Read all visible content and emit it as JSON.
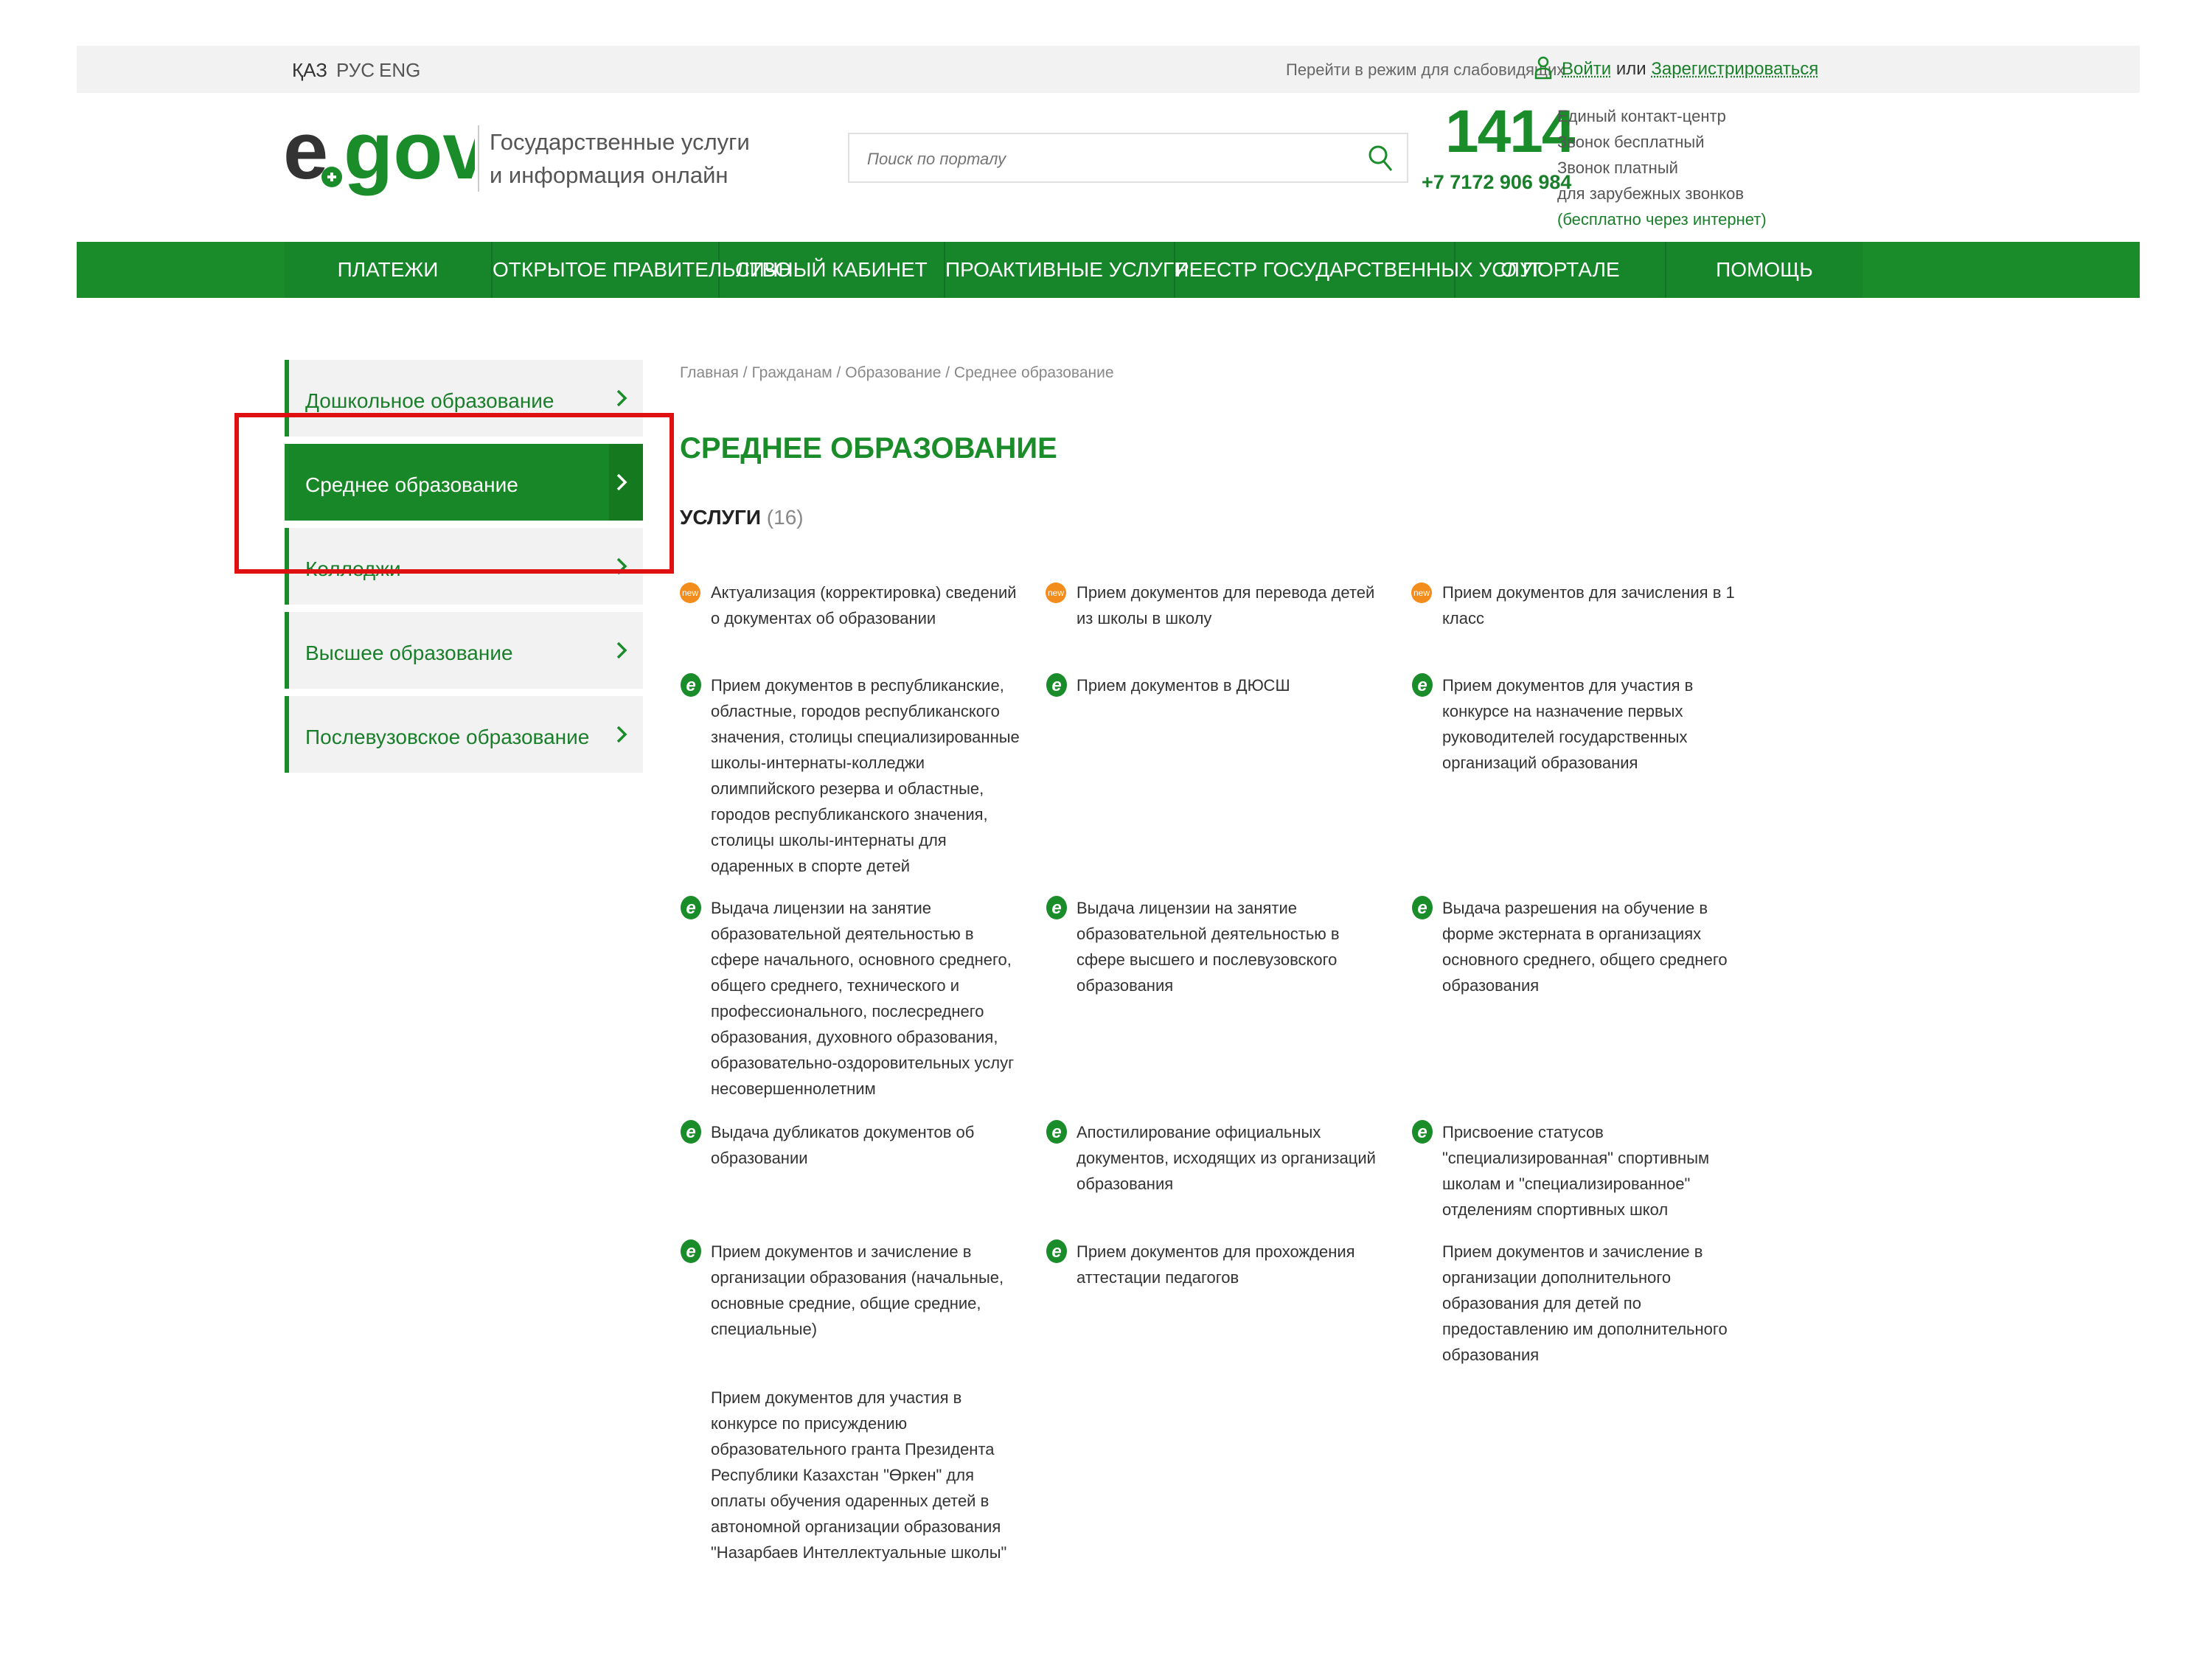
{
  "topbar": {
    "languages": [
      "ҚАЗ",
      "РУС",
      "ENG"
    ],
    "low_vision": "Перейти в режим для слабовидящих",
    "login": "Войти",
    "or": "или",
    "register": "Зарегистрироваться"
  },
  "header": {
    "logo_text": "e.gov",
    "tagline_line1": "Государственные услуги",
    "tagline_line2": "и информация онлайн",
    "search_placeholder": "Поиск по порталу",
    "contact_number": "1414",
    "contact_phone": "+7 7172 906 984",
    "contact_lines": [
      "Единый контакт-центр",
      "Звонок бесплатный",
      "Звонок платный",
      "для зарубежных звонков"
    ],
    "contact_link": "(бесплатно через интернет)"
  },
  "nav": {
    "items": [
      "ПЛАТЕЖИ",
      "ОТКРЫТОЕ ПРАВИТЕЛЬСТВО",
      "ЛИЧНЫЙ КАБИНЕТ",
      "ПРОАКТИВНЫЕ УСЛУГИ",
      "РЕЕСТР ГОСУДАРСТВЕННЫХ УСЛУГ",
      "О ПОРТАЛЕ",
      "ПОМОЩЬ"
    ]
  },
  "sidebar": {
    "items": [
      {
        "label": "Дошкольное образование",
        "active": false
      },
      {
        "label": "Среднее образование",
        "active": true
      },
      {
        "label": "Колледжи",
        "active": false
      },
      {
        "label": "Высшее образование",
        "active": false
      },
      {
        "label": "Послевузовское образование",
        "active": false
      }
    ]
  },
  "breadcrumb": {
    "items": [
      "Главная",
      "Гражданам",
      "Образование",
      "Среднее образование"
    ],
    "sep": " / "
  },
  "main": {
    "title": "СРЕДНЕЕ ОБРАЗОВАНИЕ",
    "services_label": "УСЛУГИ",
    "services_count": "(16)"
  },
  "services": [
    {
      "badge": "new",
      "text": "Актуализация (корректировка) сведений о документах об образовании"
    },
    {
      "badge": "new",
      "text": "Прием документов для перевода детей из школы в школу"
    },
    {
      "badge": "new",
      "text": "Прием документов для зачисления в 1 класс"
    },
    {
      "badge": "e",
      "text": "Прием документов в республиканские, областные, городов республиканского значения, столицы специализированные школы-интернаты-колледжи олимпийского резерва и областные, городов республиканского значения, столицы школы-интернаты для одаренных в спорте детей"
    },
    {
      "badge": "e",
      "text": "Прием документов в ДЮСШ"
    },
    {
      "badge": "e",
      "text": "Прием документов для участия в конкурсе на назначение первых руководителей государственных организаций образования"
    },
    {
      "badge": "e",
      "text": "Выдача лицензии на занятие образовательной деятельностью в сфере начального, основного среднего, общего среднего, технического и профессионального, послесреднего образования, духовного образования, образовательно-оздоровительных услуг несовершеннолетним"
    },
    {
      "badge": "e",
      "text": "Выдача лицензии на занятие образовательной деятельностью в сфере высшего и послевузовского образования"
    },
    {
      "badge": "e",
      "text": "Выдача разрешения на обучение в форме экстерната в организациях основного среднего, общего среднего образования"
    },
    {
      "badge": "e",
      "text": "Выдача дубликатов документов об образовании"
    },
    {
      "badge": "e",
      "text": "Апостилирование официальных документов, исходящих из организаций образования"
    },
    {
      "badge": "e",
      "text": "Присвоение статусов \"специализированная\" спортивным школам и \"специализированное\" отделениям спортивных школ"
    },
    {
      "badge": "e",
      "text": "Прием документов и зачисление в организации образования (начальные, основные средние, общие средние, специальные)"
    },
    {
      "badge": "e",
      "text": "Прием документов для прохождения аттестации педагогов"
    },
    {
      "badge": "none",
      "text": "Прием документов и зачисление в организации дополнительного образования для детей по предоставлению им дополнительного образования"
    },
    {
      "badge": "none",
      "text": "Прием документов для участия в конкурсе по присуждению образовательного гранта Президента Республики Казахстан \"Өркен\" для оплаты обучения одаренных детей в автономной организации образования \"Назарбаев Интеллектуальные школы\""
    }
  ],
  "colors": {
    "brand_green": "#1a8c2a",
    "highlight_red": "#e01010",
    "new_badge_orange": "#f28c1a"
  }
}
